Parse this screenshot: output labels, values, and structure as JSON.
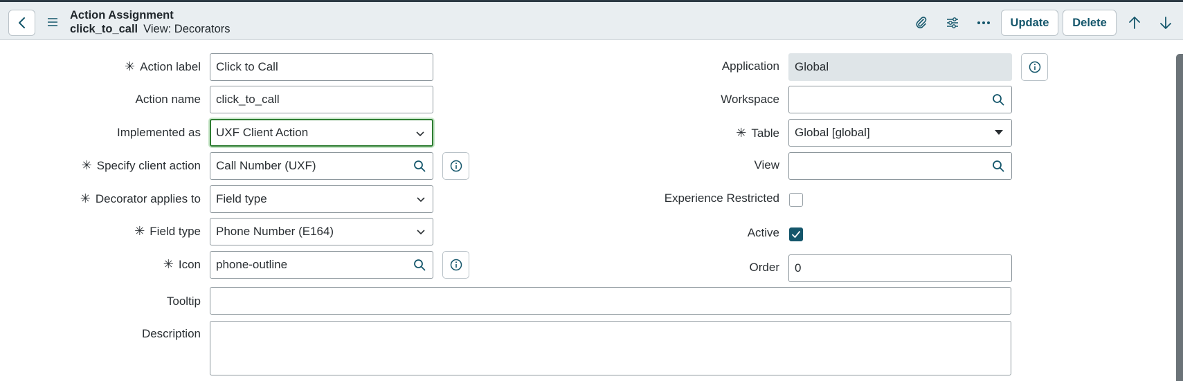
{
  "header": {
    "title": "Action Assignment",
    "record_name": "click_to_call",
    "view_text": "View: Decorators",
    "update_label": "Update",
    "delete_label": "Delete",
    "icons": [
      "back-icon",
      "hamburger-menu-icon",
      "paperclip-icon",
      "sliders-icon",
      "more-options-icon",
      "arrow-up-icon",
      "arrow-down-icon"
    ]
  },
  "form": {
    "action_label": {
      "label": "Action label",
      "required": true,
      "value": "Click to Call"
    },
    "action_name": {
      "label": "Action name",
      "value": "click_to_call"
    },
    "implemented_as": {
      "label": "Implemented as",
      "value": "UXF Client Action"
    },
    "specify_client_action": {
      "label": "Specify client action",
      "required": true,
      "value": "Call Number (UXF)"
    },
    "decorator_applies_to": {
      "label": "Decorator applies to",
      "required": true,
      "value": "Field type"
    },
    "field_type": {
      "label": "Field type",
      "required": true,
      "value": "Phone Number (E164)"
    },
    "icon": {
      "label": "Icon",
      "required": true,
      "value": "phone-outline"
    },
    "tooltip": {
      "label": "Tooltip",
      "value": ""
    },
    "description": {
      "label": "Description",
      "value": ""
    },
    "application": {
      "label": "Application",
      "value": "Global"
    },
    "workspace": {
      "label": "Workspace",
      "value": ""
    },
    "table": {
      "label": "Table",
      "required": true,
      "value": "Global [global]"
    },
    "view": {
      "label": "View",
      "value": ""
    },
    "experience_restricted": {
      "label": "Experience Restricted",
      "checked": false
    },
    "active": {
      "label": "Active",
      "checked": true
    },
    "order": {
      "label": "Order",
      "value": "0"
    }
  },
  "required_marker": "✳",
  "colors": {
    "accent": "#14566b",
    "focus": "#2e7d32",
    "header_bg": "#e9eef1"
  }
}
